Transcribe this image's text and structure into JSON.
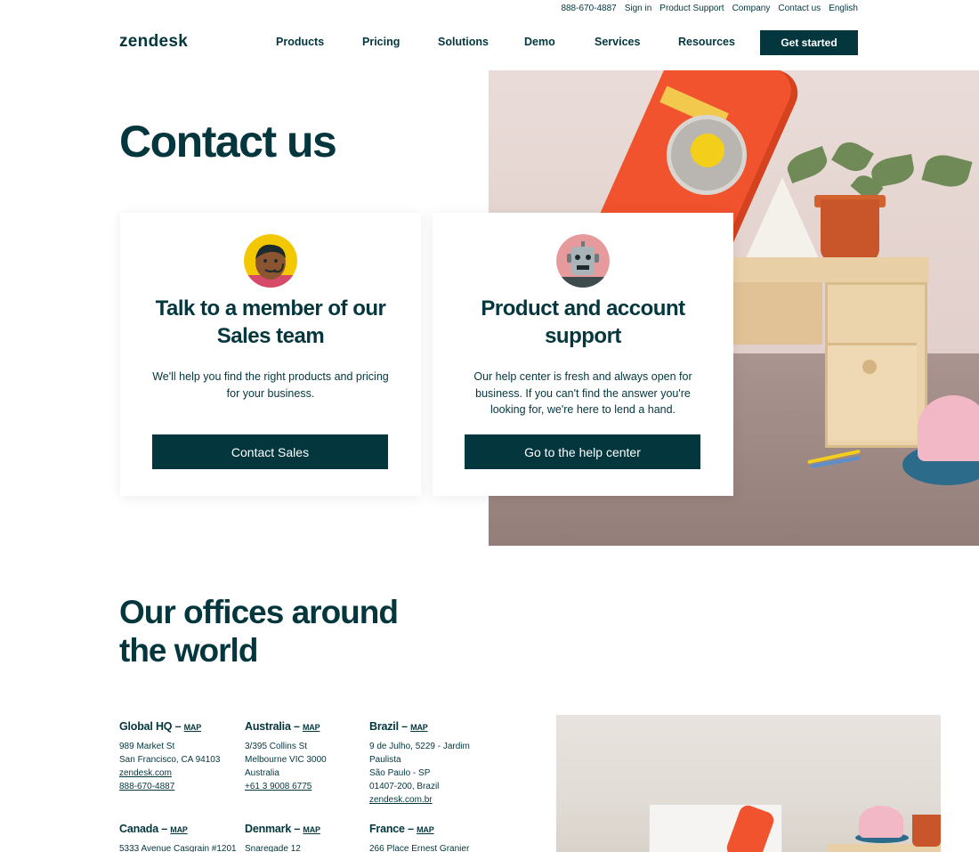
{
  "utility_nav": {
    "phone": "888-670-4887",
    "sign_in": "Sign in",
    "product_support": "Product Support",
    "company": "Company",
    "contact_us": "Contact us",
    "language": "English"
  },
  "logo": "zendesk",
  "main_nav": {
    "products": "Products",
    "pricing": "Pricing",
    "solutions": "Solutions",
    "demo": "Demo",
    "services": "Services",
    "resources": "Resources",
    "cta": "Get started"
  },
  "hero": {
    "title": "Contact us"
  },
  "cards": {
    "sales": {
      "title": "Talk to a member of our Sales team",
      "body": "We'll help you find the right products and pricing for your business.",
      "button": "Contact Sales"
    },
    "support": {
      "title": "Product and account support",
      "body": "Our help center is fresh and always open for business. If you can't find the answer you're looking for, we're here to lend a hand.",
      "button": "Go to the help center"
    }
  },
  "offices": {
    "title": "Our offices around the world",
    "map_label": "MAP",
    "global_hq": {
      "name": "Global HQ –",
      "line1": "989 Market St",
      "line2": "San Francisco, CA 94103",
      "link1": "zendesk.com",
      "link2": "888-670-4887"
    },
    "australia": {
      "name": "Australia –",
      "line1": "3/395 Collins St",
      "line2": "Melbourne VIC 3000",
      "line3": "Australia",
      "link1": "+61 3 9008 6775"
    },
    "brazil": {
      "name": "Brazil –",
      "line1": "9 de Julho, 5229 - Jardim",
      "line2": "Paulista",
      "line3": "São Paulo - SP",
      "line4": "01407-200, Brazil",
      "link1": "zendesk.com.br"
    },
    "canada": {
      "name": "Canada –",
      "line1": "5333 Avenue Casgrain #1201"
    },
    "denmark": {
      "name": "Denmark –",
      "line1": "Snaregade 12"
    },
    "france": {
      "name": "France –",
      "line1": "266 Place Ernest Granier"
    }
  },
  "colors": {
    "brand_dark": "#03363d",
    "background": "#ffffff"
  }
}
